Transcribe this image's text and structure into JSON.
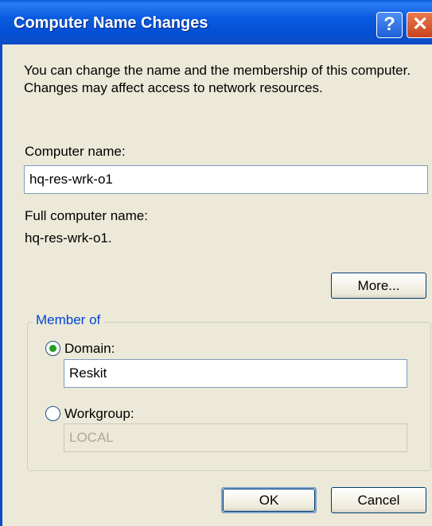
{
  "window": {
    "title": "Computer Name Changes",
    "help_glyph": "?",
    "close_glyph": "✕"
  },
  "description": "You can change the name and the membership of this computer. Changes may affect access to network resources.",
  "computer_name": {
    "label": "Computer name:",
    "value": "hq-res-wrk-o1"
  },
  "full_name": {
    "label": "Full computer name:",
    "value": "hq-res-wrk-o1."
  },
  "more_button": "More...",
  "member_of": {
    "label": "Member of",
    "domain": {
      "label": "Domain:",
      "value": "Reskit",
      "selected": true
    },
    "workgroup": {
      "label": "Workgroup:",
      "value": "LOCAL",
      "selected": false
    }
  },
  "buttons": {
    "ok": "OK",
    "cancel": "Cancel"
  },
  "colors": {
    "title_bar": "#0a5ad8",
    "dialog_bg": "#ece9d8",
    "group_label": "#0046d5"
  }
}
